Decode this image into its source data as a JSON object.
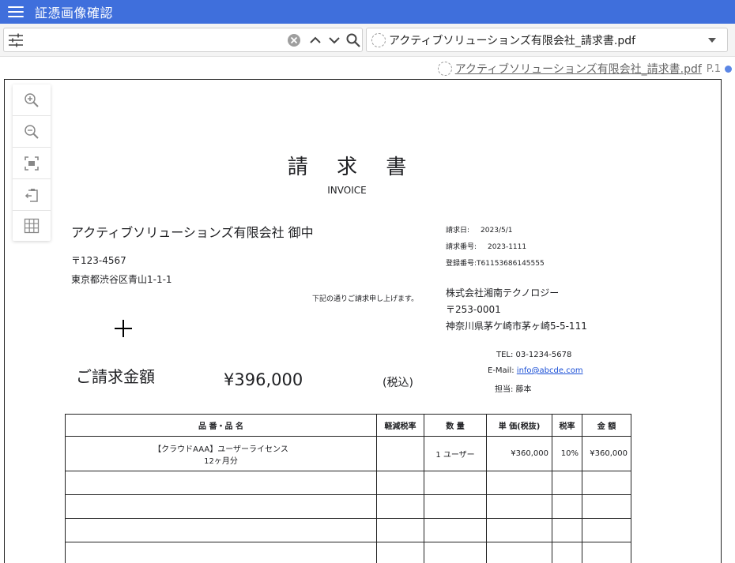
{
  "app": {
    "title": "証憑画像確認"
  },
  "toolbar": {
    "search_value": "",
    "search_placeholder": "",
    "selected_file": "アクティブソリューションズ有限会社_請求書.pdf"
  },
  "fileinfo": {
    "file_name": "アクティブソリューションズ有限会社_請求書.pdf",
    "page": "P.1"
  },
  "icons": {
    "menu": "hamburger-icon",
    "filter": "tune-icon",
    "clear": "clear-circle-icon",
    "prev": "chevron-up-icon",
    "next": "chevron-down-icon",
    "search": "search-icon",
    "zoom_in": "zoom-in-icon",
    "zoom_out": "zoom-out-icon",
    "fit": "fit-screen-icon",
    "rotate": "rotate-page-icon",
    "grid": "grid-icon"
  },
  "colors": {
    "header_bg": "#3f6fdc",
    "status_dot": "#5b86e5",
    "link": "#1a4fd6"
  },
  "invoice": {
    "title": "請 求 書",
    "subtitle": "INVOICE",
    "customer": "アクティブソリューションズ有限会社 御中",
    "customer_zip": "〒123-4567",
    "customer_address": "東京都渋谷区青山1-1-1",
    "note": "下記の通りご請求申し上げます。",
    "meta": [
      {
        "label": "請求日:",
        "value": "2023/5/1"
      },
      {
        "label": "請求番号:",
        "value": "2023-1111"
      },
      {
        "label": "登録番号:",
        "value": "T61153686145555"
      }
    ],
    "issuer_name": "株式会社湘南テクノロジー",
    "issuer_zip": "〒253-0001",
    "issuer_address": "神奈川県茅ケ崎市茅ヶ崎5-5-111",
    "tel": "TEL: 03-1234-5678",
    "email_label": "E-Mail:",
    "email": "info@abcde.com",
    "person": "担当: 藤本",
    "amount_label": "ご請求金額",
    "amount_value": "¥396,000",
    "tax_note": "(税込)",
    "columns": [
      "品 番・品 名",
      "軽減税率",
      "数 量",
      "単 価(税抜)",
      "税率",
      "金 額"
    ],
    "items": [
      {
        "name_line1": "【クラウドAAA】ユーザーライセンス",
        "name_line2": "12ヶ月分",
        "reduced": "",
        "qty": "1 ユーザー",
        "price": "¥360,000",
        "rate": "10%",
        "amount": "¥360,000"
      }
    ]
  }
}
